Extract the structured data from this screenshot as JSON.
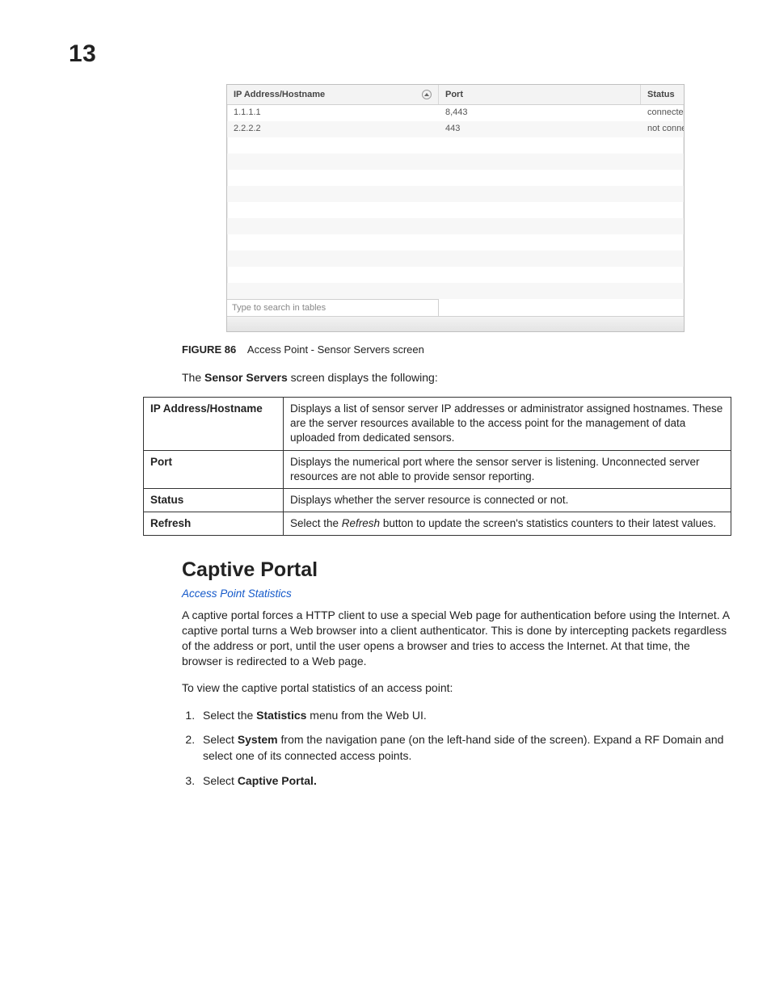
{
  "chapter_number": "13",
  "screenshot": {
    "headers": {
      "ip": "IP Address/Hostname",
      "port": "Port",
      "status": "Status"
    },
    "rows": [
      {
        "ip": "1.1.1.1",
        "port": "8,443",
        "status": "connected"
      },
      {
        "ip": "2.2.2.2",
        "port": "443",
        "status": "not connected"
      }
    ],
    "blank_rows": 10,
    "search_placeholder": "Type to search in tables"
  },
  "caption": {
    "label": "FIGURE 86",
    "text": "Access Point - Sensor Servers screen"
  },
  "intro": {
    "pre": "The ",
    "bold": "Sensor Servers",
    "post": " screen displays the following:"
  },
  "def_rows": [
    {
      "term": "IP Address/Hostname",
      "desc": "Displays a list of sensor server IP addresses or administrator assigned hostnames. These are the server resources available to the access point for the management of data uploaded from dedicated sensors."
    },
    {
      "term": "Port",
      "desc": "Displays the numerical port where the sensor server is listening. Unconnected server resources are not able to provide sensor reporting."
    },
    {
      "term": "Status",
      "desc": "Displays whether the server resource is connected or not."
    },
    {
      "term": "Refresh",
      "desc_pre": "Select the ",
      "desc_italic": "Refresh",
      "desc_post": " button to update the screen's statistics counters to their latest values."
    }
  ],
  "section": {
    "title": "Captive Portal",
    "breadcrumb": "Access Point Statistics",
    "body": "A captive portal forces a HTTP client to use a special Web page for authentication before using the Internet. A captive portal turns a Web browser into a client authenticator. This is done by intercepting packets regardless of the address or port, until the user opens a browser and tries to access the Internet. At that time, the browser is redirected to a Web page.",
    "lead": "To view the captive portal statistics of an access point:",
    "steps": {
      "s1": {
        "pre": "Select the ",
        "bold": "Statistics",
        "post": " menu from the Web UI."
      },
      "s2": {
        "pre": "Select ",
        "bold": "System",
        "post": " from the navigation pane (on the left-hand side of the screen). Expand a RF Domain and select one of its connected access points."
      },
      "s3": {
        "pre": "Select ",
        "bold": "Captive Portal.",
        "post": ""
      }
    }
  }
}
